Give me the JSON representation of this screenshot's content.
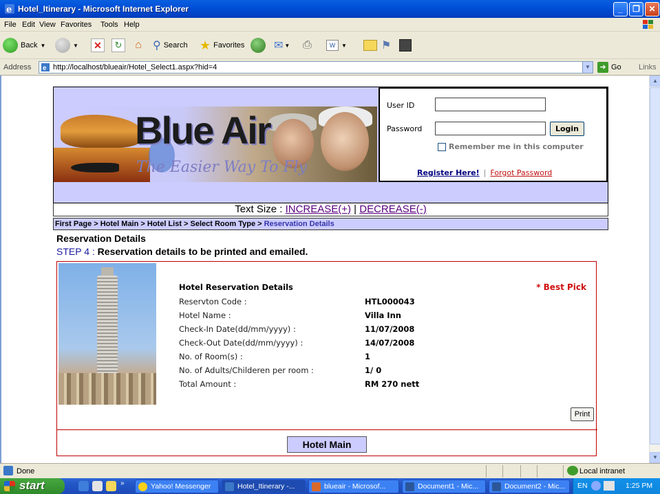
{
  "window": {
    "title": "Hotel_Itinerary - Microsoft Internet Explorer",
    "minimize": "_",
    "maximize": "❐",
    "close": "✕"
  },
  "menu": [
    "File",
    "Edit",
    "View",
    "Favorites",
    "Tools",
    "Help"
  ],
  "toolbar": {
    "back": "Back",
    "search": "Search",
    "favorites": "Favorites"
  },
  "address": {
    "label": "Address",
    "url": "http://localhost/blueair/Hotel_Select1.aspx?hid=4",
    "go": "Go",
    "links": "Links"
  },
  "header": {
    "brand": "Blue Air",
    "slogan": "The Easier Way To Fly",
    "login": {
      "user_label": "User ID",
      "password_label": "Password",
      "user_value": "",
      "password_value": "",
      "login_button": "Login",
      "remember": "Remember me in this computer",
      "register": "Register Here!",
      "separator": "|",
      "forgot": "Forgot Password"
    }
  },
  "text_size": {
    "label": "Text Size  : ",
    "increase": "INCREASE(+)",
    "separator": " | ",
    "decrease": "DECREASE(-)"
  },
  "breadcrumb": {
    "trail": "First Page  > Hotel Main > Hotel List > Select Room Type > ",
    "current": "Reservation Details"
  },
  "page": {
    "title": "Reservation Details",
    "step_label": "STEP 4 : ",
    "step_text": "Reservation  details to be printed and emailed."
  },
  "reservation": {
    "heading": "Hotel Reservation Details",
    "best_pick": "* Best Pick",
    "rows": [
      {
        "label": "Reservton Code :",
        "value": "HTL000043"
      },
      {
        "label": "Hotel Name :",
        "value": "Villa Inn"
      },
      {
        "label": "Check-In Date(dd/mm/yyyy) :",
        "value": "11/07/2008"
      },
      {
        "label": "Check-Out Date(dd/mm/yyyy) :",
        "value": "14/07/2008"
      },
      {
        "label": "No. of Room(s) :",
        "value": "1"
      },
      {
        "label": "No. of Adults/Childeren per room :",
        "value": "1/ 0"
      },
      {
        "label": "Total Amount :",
        "value": "RM 270 nett"
      }
    ],
    "print": "Print",
    "hotel_main": "Hotel Main"
  },
  "status": {
    "text": "Done",
    "zone": "Local intranet"
  },
  "taskbar": {
    "start": "start",
    "tasks": [
      "Yahoo! Messenger",
      "Hotel_Itinerary -...",
      "blueair - Microsof...",
      "Document1 - Mic...",
      "Document2 - Mic..."
    ],
    "lang": "EN",
    "clock": "1:25 PM"
  }
}
